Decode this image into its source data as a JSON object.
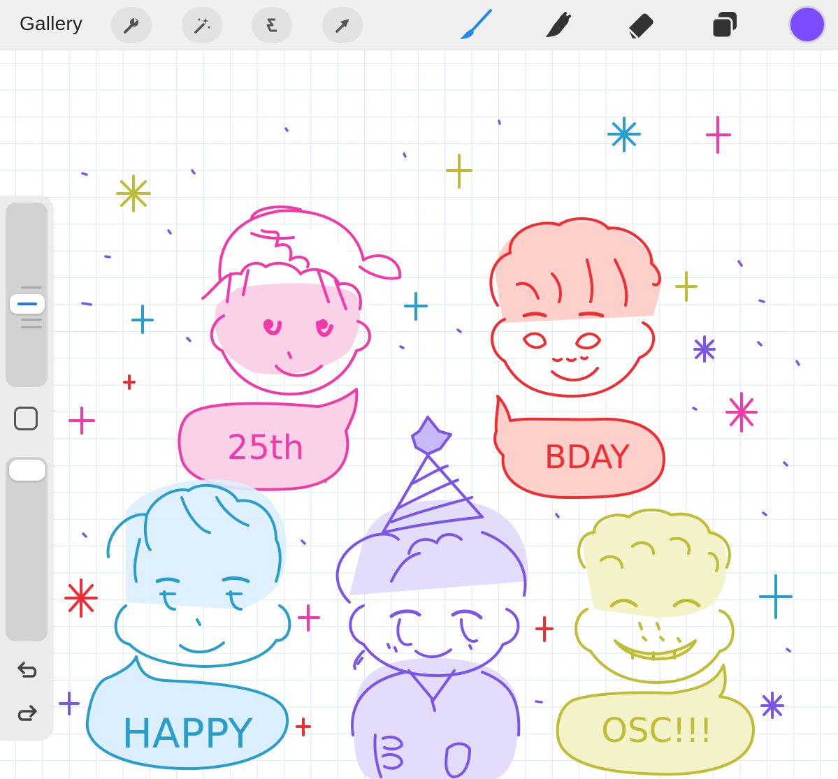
{
  "toolbar": {
    "gallery_label": "Gallery",
    "actions_icon": "wrench-icon",
    "adjustments_icon": "magic-wand-icon",
    "selection_icon": "selection-s-icon",
    "transform_icon": "arrow-cursor-icon",
    "brush_icon": "paintbrush-icon",
    "smudge_icon": "smudge-finger-icon",
    "eraser_icon": "eraser-icon",
    "layers_icon": "layers-icon",
    "active_tool": "brush",
    "active_color": "#7b4cff"
  },
  "sidebar": {
    "brush_size_icon": "brush-size-slider",
    "modify_icon": "square-modify-icon",
    "opacity_icon": "opacity-slider",
    "undo_icon": "undo-arrow-icon",
    "redo_icon": "redo-arrow-icon"
  },
  "artwork": {
    "colors": {
      "pink": "#f03aa8",
      "red": "#ee2e32",
      "blue": "#2a9ecb",
      "purple": "#7a55e8",
      "olive": "#bdbd36"
    },
    "bubbles": {
      "pink": "25th",
      "red": "BDAY",
      "blue": "HAPPY",
      "olive": "OSC!!!"
    }
  }
}
